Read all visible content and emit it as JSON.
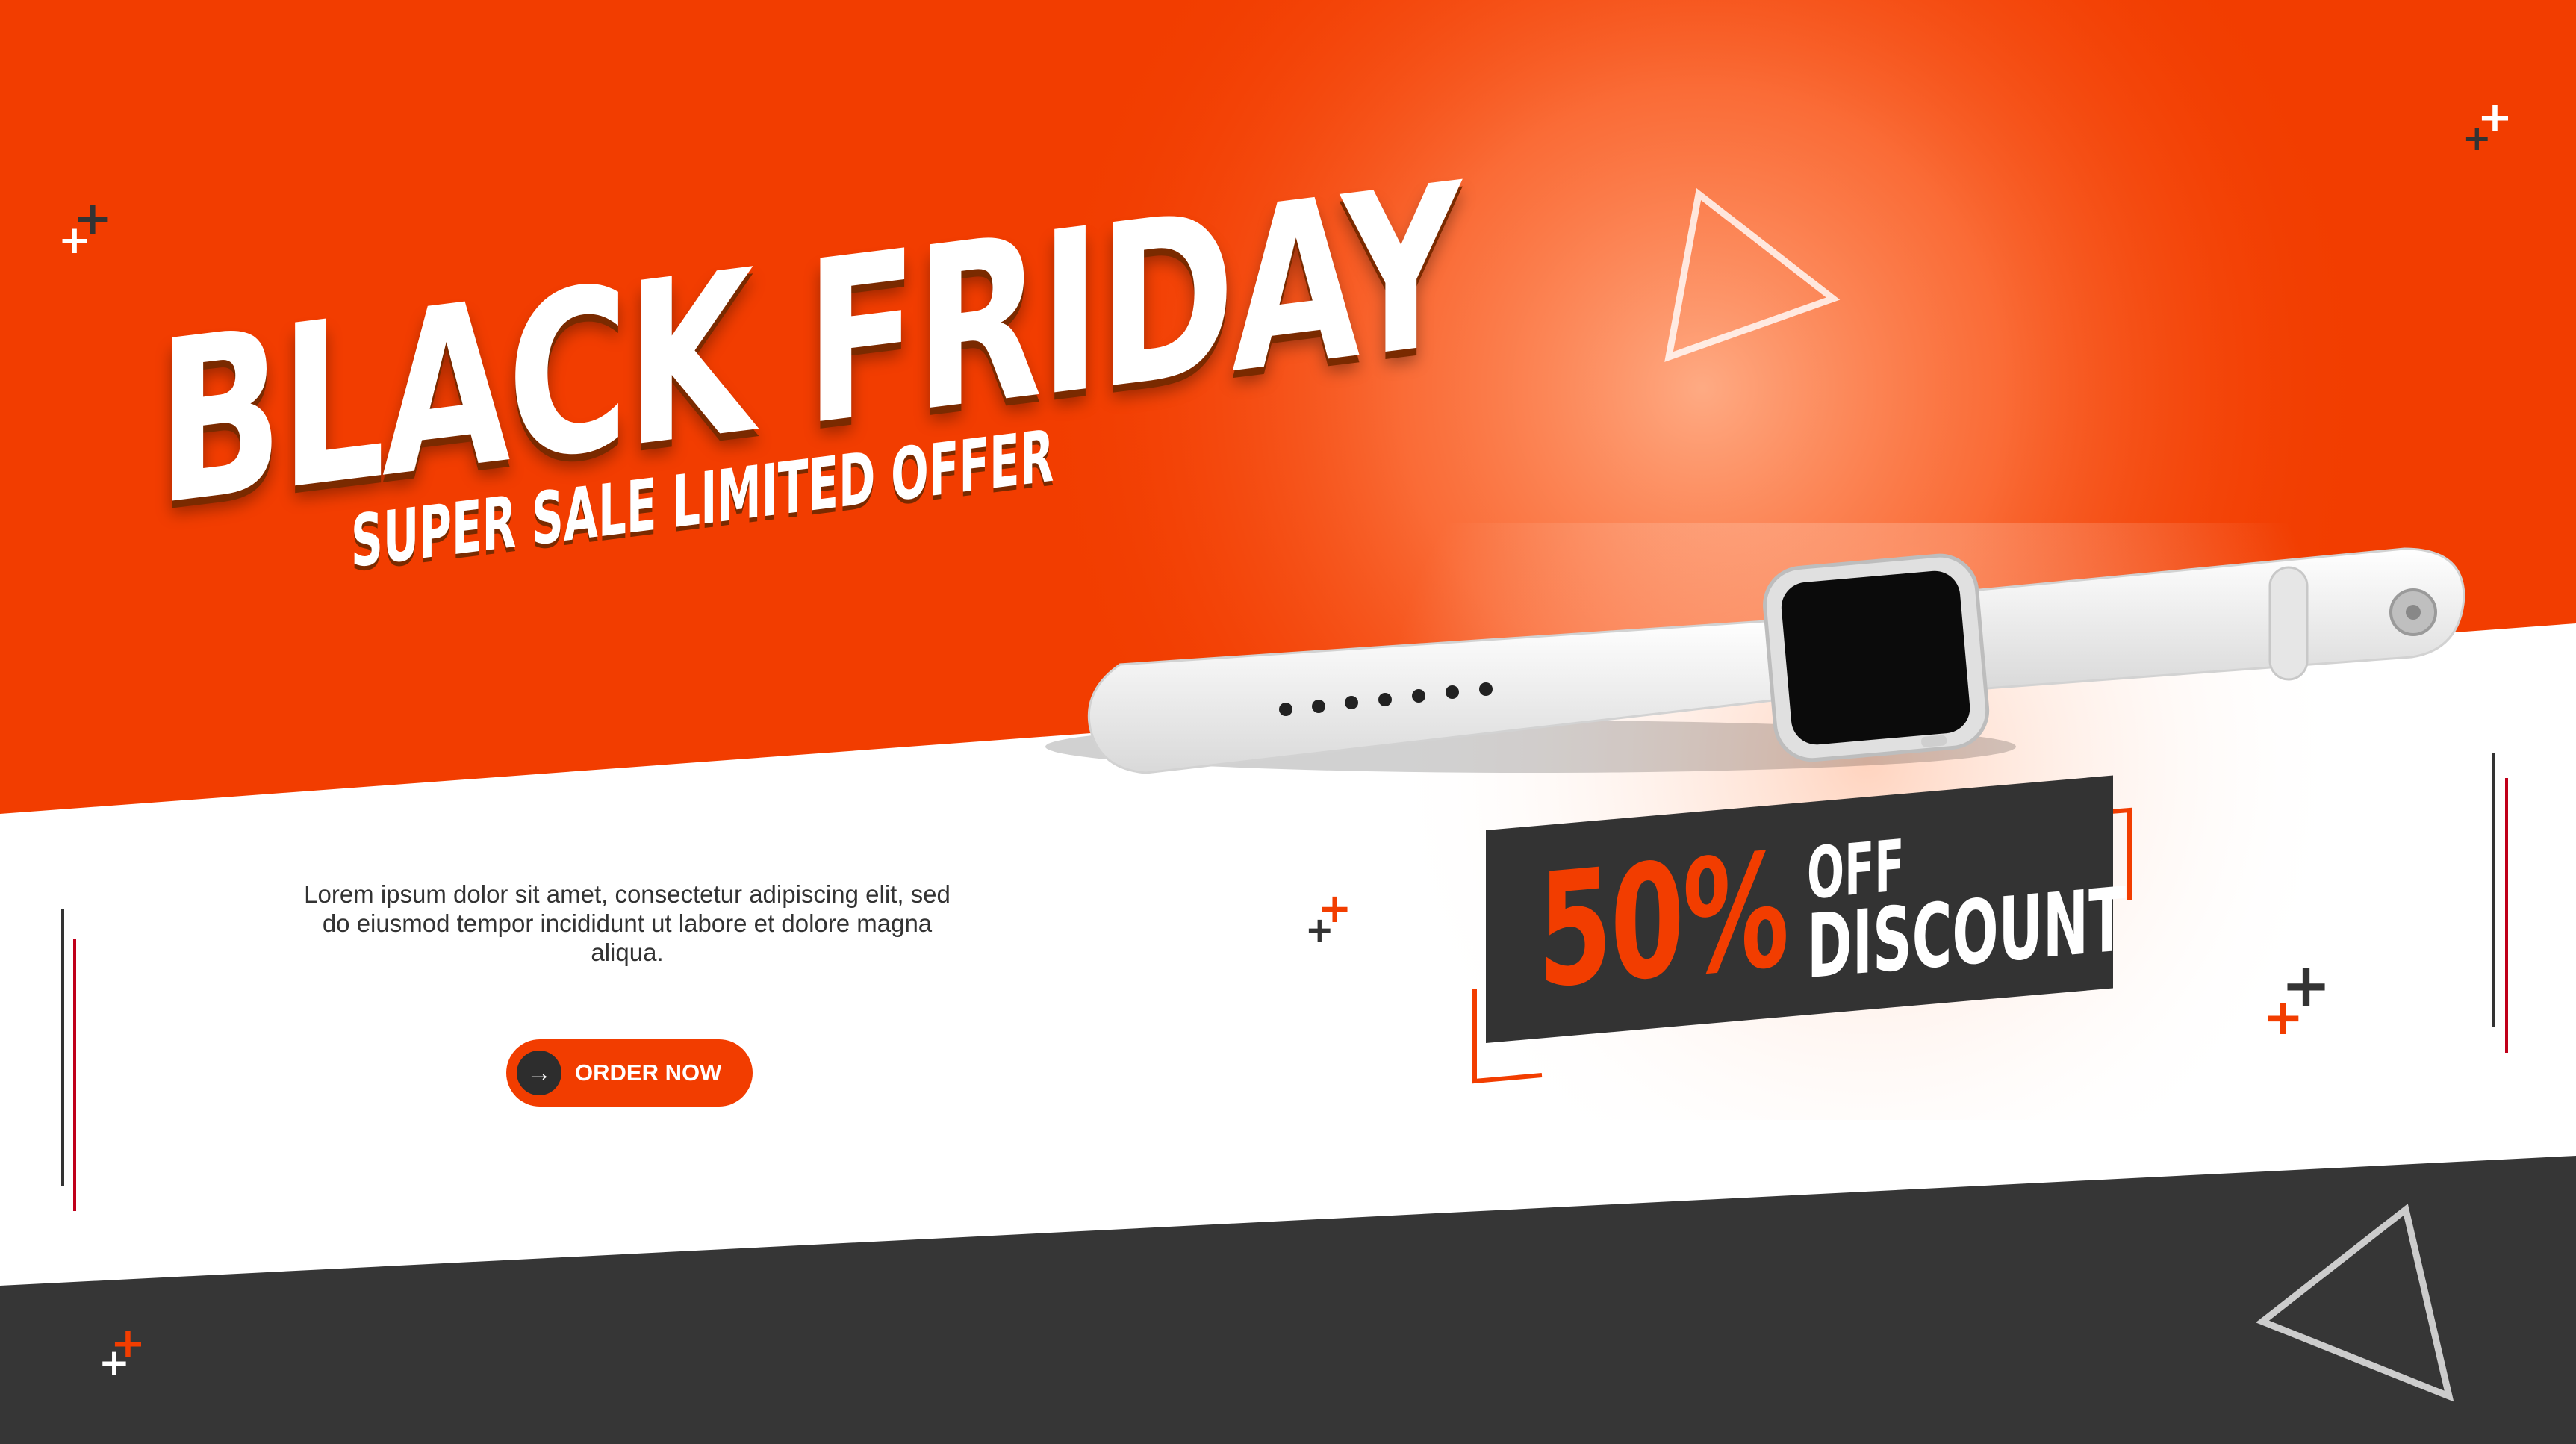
{
  "banner": {
    "title": "BLACK FRIDAY",
    "subtitle": "SUPER SALE LIMITED OFFER",
    "description": "Lorem ipsum dolor sit amet, consectetur adipiscing elit, sed do eiusmod tempor incididunt ut labore et dolore magna aliqua.",
    "cta_label": "ORDER NOW",
    "cta_icon": "arrow-right-icon",
    "discount_percent": "50%",
    "discount_off": "OFF",
    "discount_word": "DISCOUNT",
    "product": "smartwatch-image"
  },
  "colors": {
    "accent": "#f23d00",
    "dark": "#333333",
    "light": "#ffffff"
  }
}
